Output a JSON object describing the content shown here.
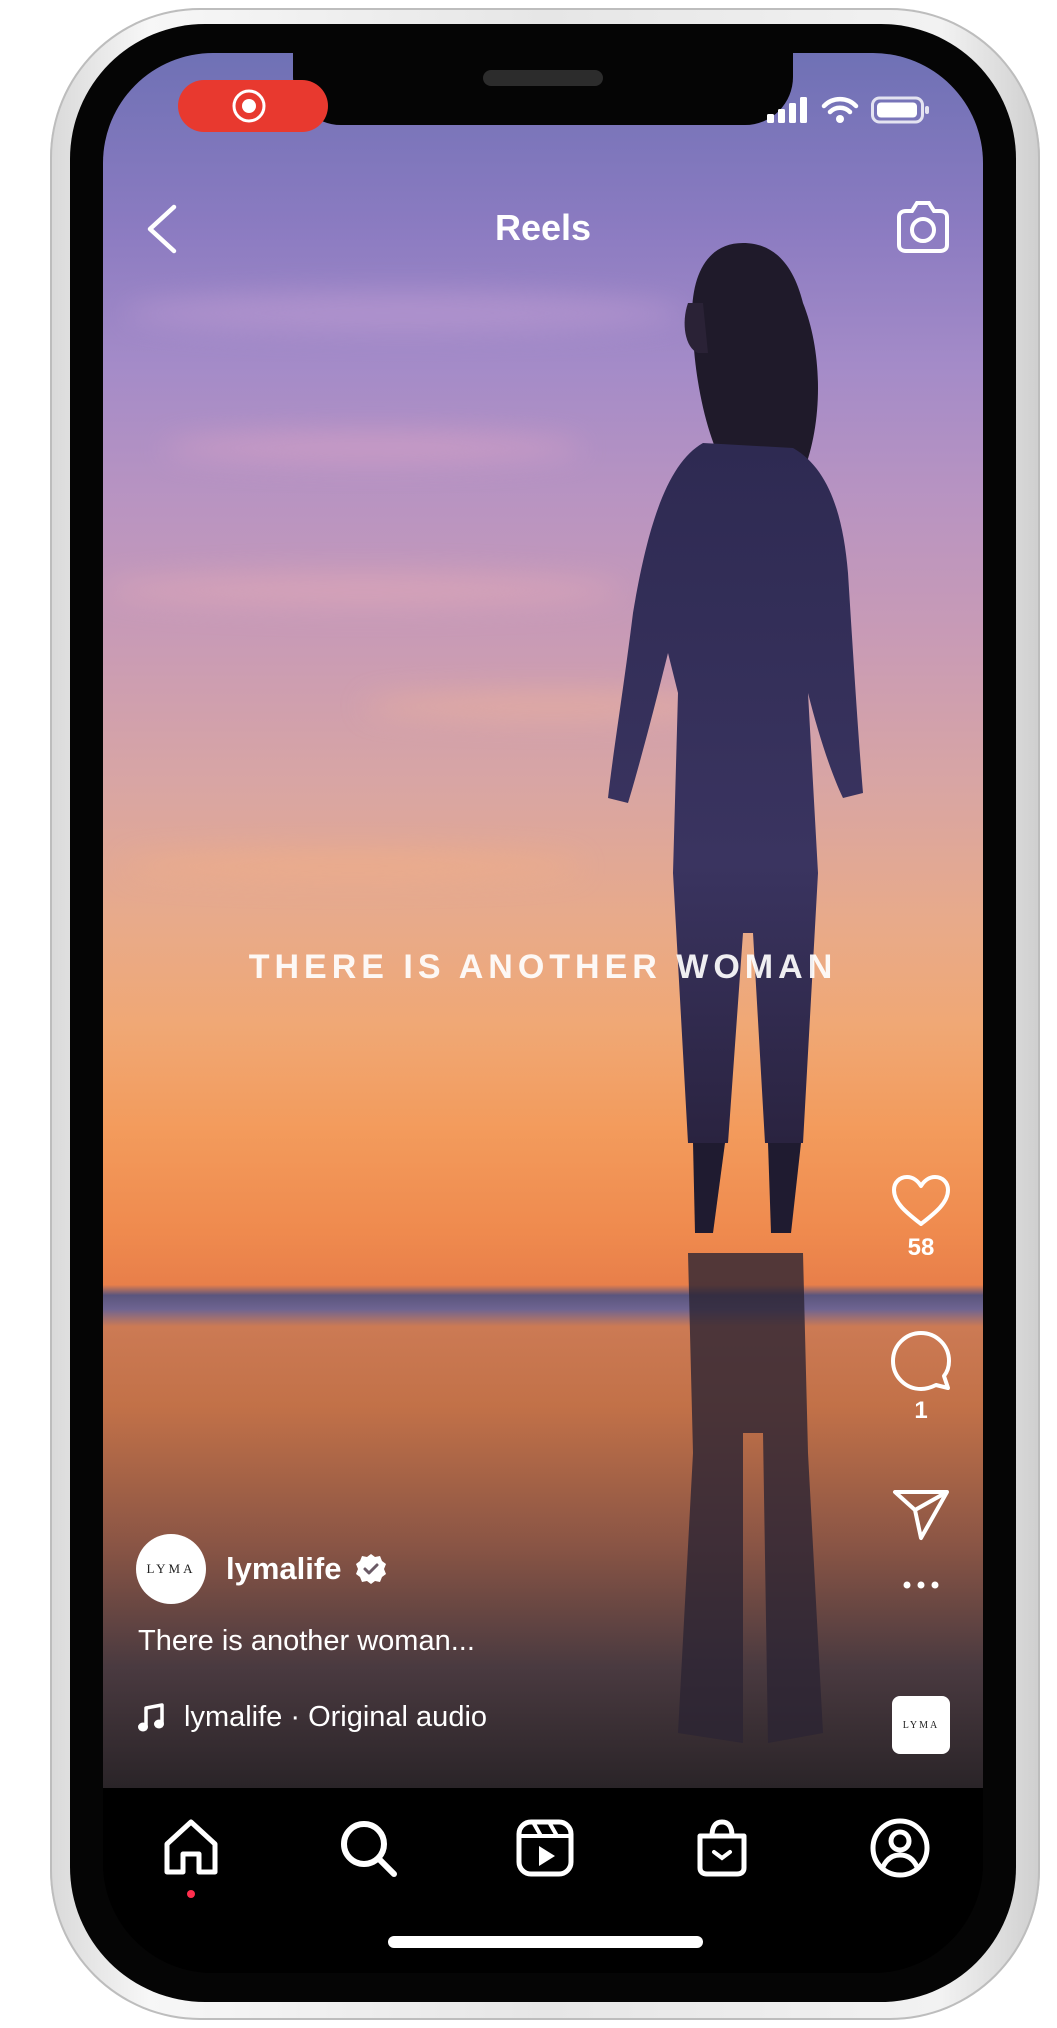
{
  "header": {
    "title": "Reels"
  },
  "video": {
    "overlay_text": "THERE IS ANOTHER WOMAN"
  },
  "actions": {
    "likes": "58",
    "comments": "1"
  },
  "post": {
    "username": "lymalife",
    "avatar_text": "LYMA",
    "caption": "There is another woman...",
    "audio": "lymalife · Original audio",
    "audio_thumb_text": "LYMA"
  },
  "colors": {
    "record": "#e8392f",
    "notification_dot": "#ff2e4d"
  },
  "nav": [
    "home-icon",
    "search-icon",
    "reels-icon",
    "shop-icon",
    "profile-icon"
  ]
}
